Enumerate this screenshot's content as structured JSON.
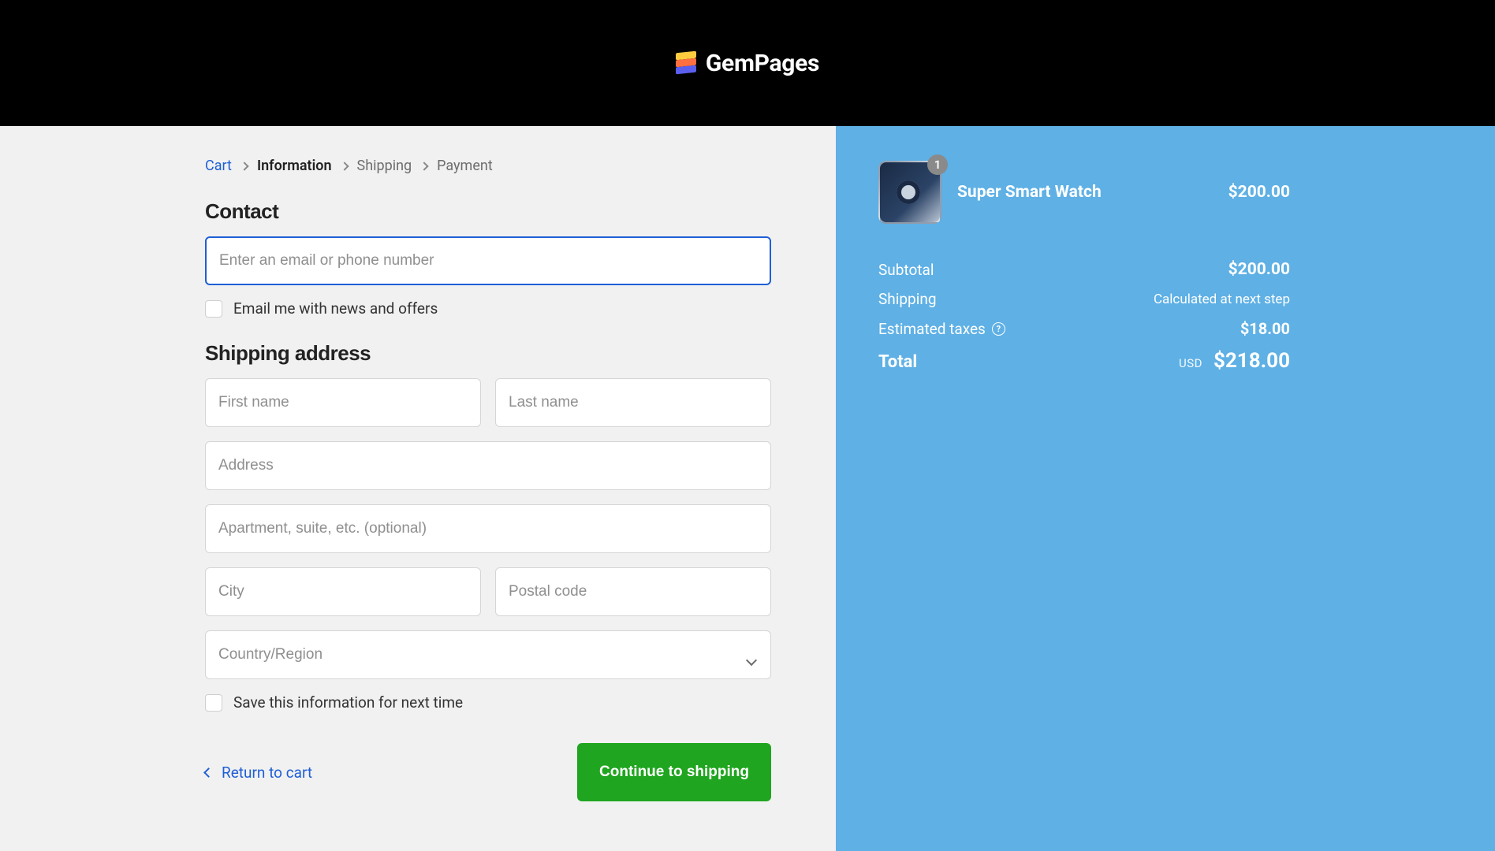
{
  "brand": {
    "name": "GemPages"
  },
  "breadcrumb": {
    "cart": "Cart",
    "information": "Information",
    "shipping": "Shipping",
    "payment": "Payment"
  },
  "contact": {
    "heading": "Contact",
    "email_placeholder": "Enter an email or phone number",
    "news_offers_label": "Email me with news and offers"
  },
  "shipping_address": {
    "heading": "Shipping address",
    "first_name_placeholder": "First name",
    "last_name_placeholder": "Last name",
    "address_placeholder": "Address",
    "apartment_placeholder": "Apartment, suite, etc. (optional)",
    "city_placeholder": "City",
    "postal_placeholder": "Postal code",
    "country_placeholder": "Country/Region",
    "save_info_label": "Save this information for next time"
  },
  "actions": {
    "return_label": "Return to cart",
    "continue_label": "Continue to shipping"
  },
  "order": {
    "product": {
      "name": "Super Smart Watch",
      "price": "$200.00",
      "qty": "1"
    },
    "subtotal_label": "Subtotal",
    "subtotal_value": "$200.00",
    "shipping_label": "Shipping",
    "shipping_value": "Calculated at next step",
    "tax_label": "Estimated taxes",
    "tax_value": "$18.00",
    "total_label": "Total",
    "total_currency": "USD",
    "total_value": "$218.00"
  }
}
